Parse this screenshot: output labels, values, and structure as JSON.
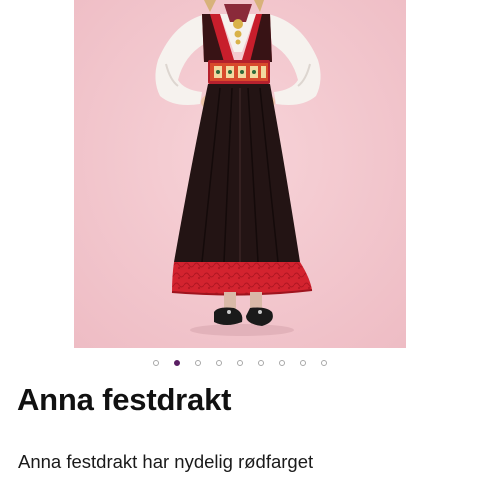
{
  "product": {
    "title": "Anna festdrakt",
    "description": "Anna festdrakt har nydelig rødfarget"
  },
  "gallery": {
    "image_subject": "girl-in-bunad-photo",
    "dot_count": 9,
    "active_index": 1
  },
  "colors": {
    "background_pink": "#f3c9cf",
    "skirt_black": "#231414",
    "bodice_red": "#c81e2c",
    "hem_red": "#d3232f",
    "dot_active": "#5a1e63",
    "dot_inactive": "#a8a8a8"
  }
}
